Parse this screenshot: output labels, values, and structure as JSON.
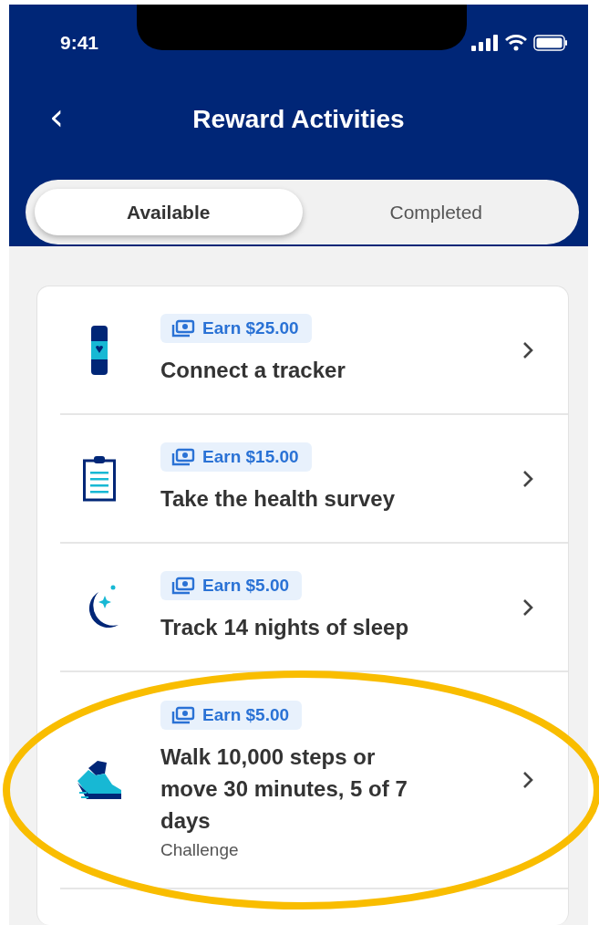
{
  "status_bar": {
    "time": "9:41"
  },
  "header": {
    "back": "‹",
    "title": "Reward Activities"
  },
  "tabs": [
    {
      "label": "Available",
      "selected": true
    },
    {
      "label": "Completed",
      "selected": false
    }
  ],
  "activities": [
    {
      "kind": "tracker",
      "reward": "Earn $25.00",
      "title": "Connect a tracker",
      "highlighted": false
    },
    {
      "kind": "clipboard",
      "reward": "Earn $15.00",
      "title": "Take the health survey",
      "highlighted": false
    },
    {
      "kind": "moon",
      "reward": "Earn $5.00",
      "title": "Track 14 nights of sleep",
      "highlighted": false
    },
    {
      "kind": "shoe",
      "reward": "Earn $5.00",
      "title": "Walk 10,000 steps or move 30 minutes, 5 of 7 days",
      "subtitle": "Challenge",
      "highlighted": true
    }
  ]
}
